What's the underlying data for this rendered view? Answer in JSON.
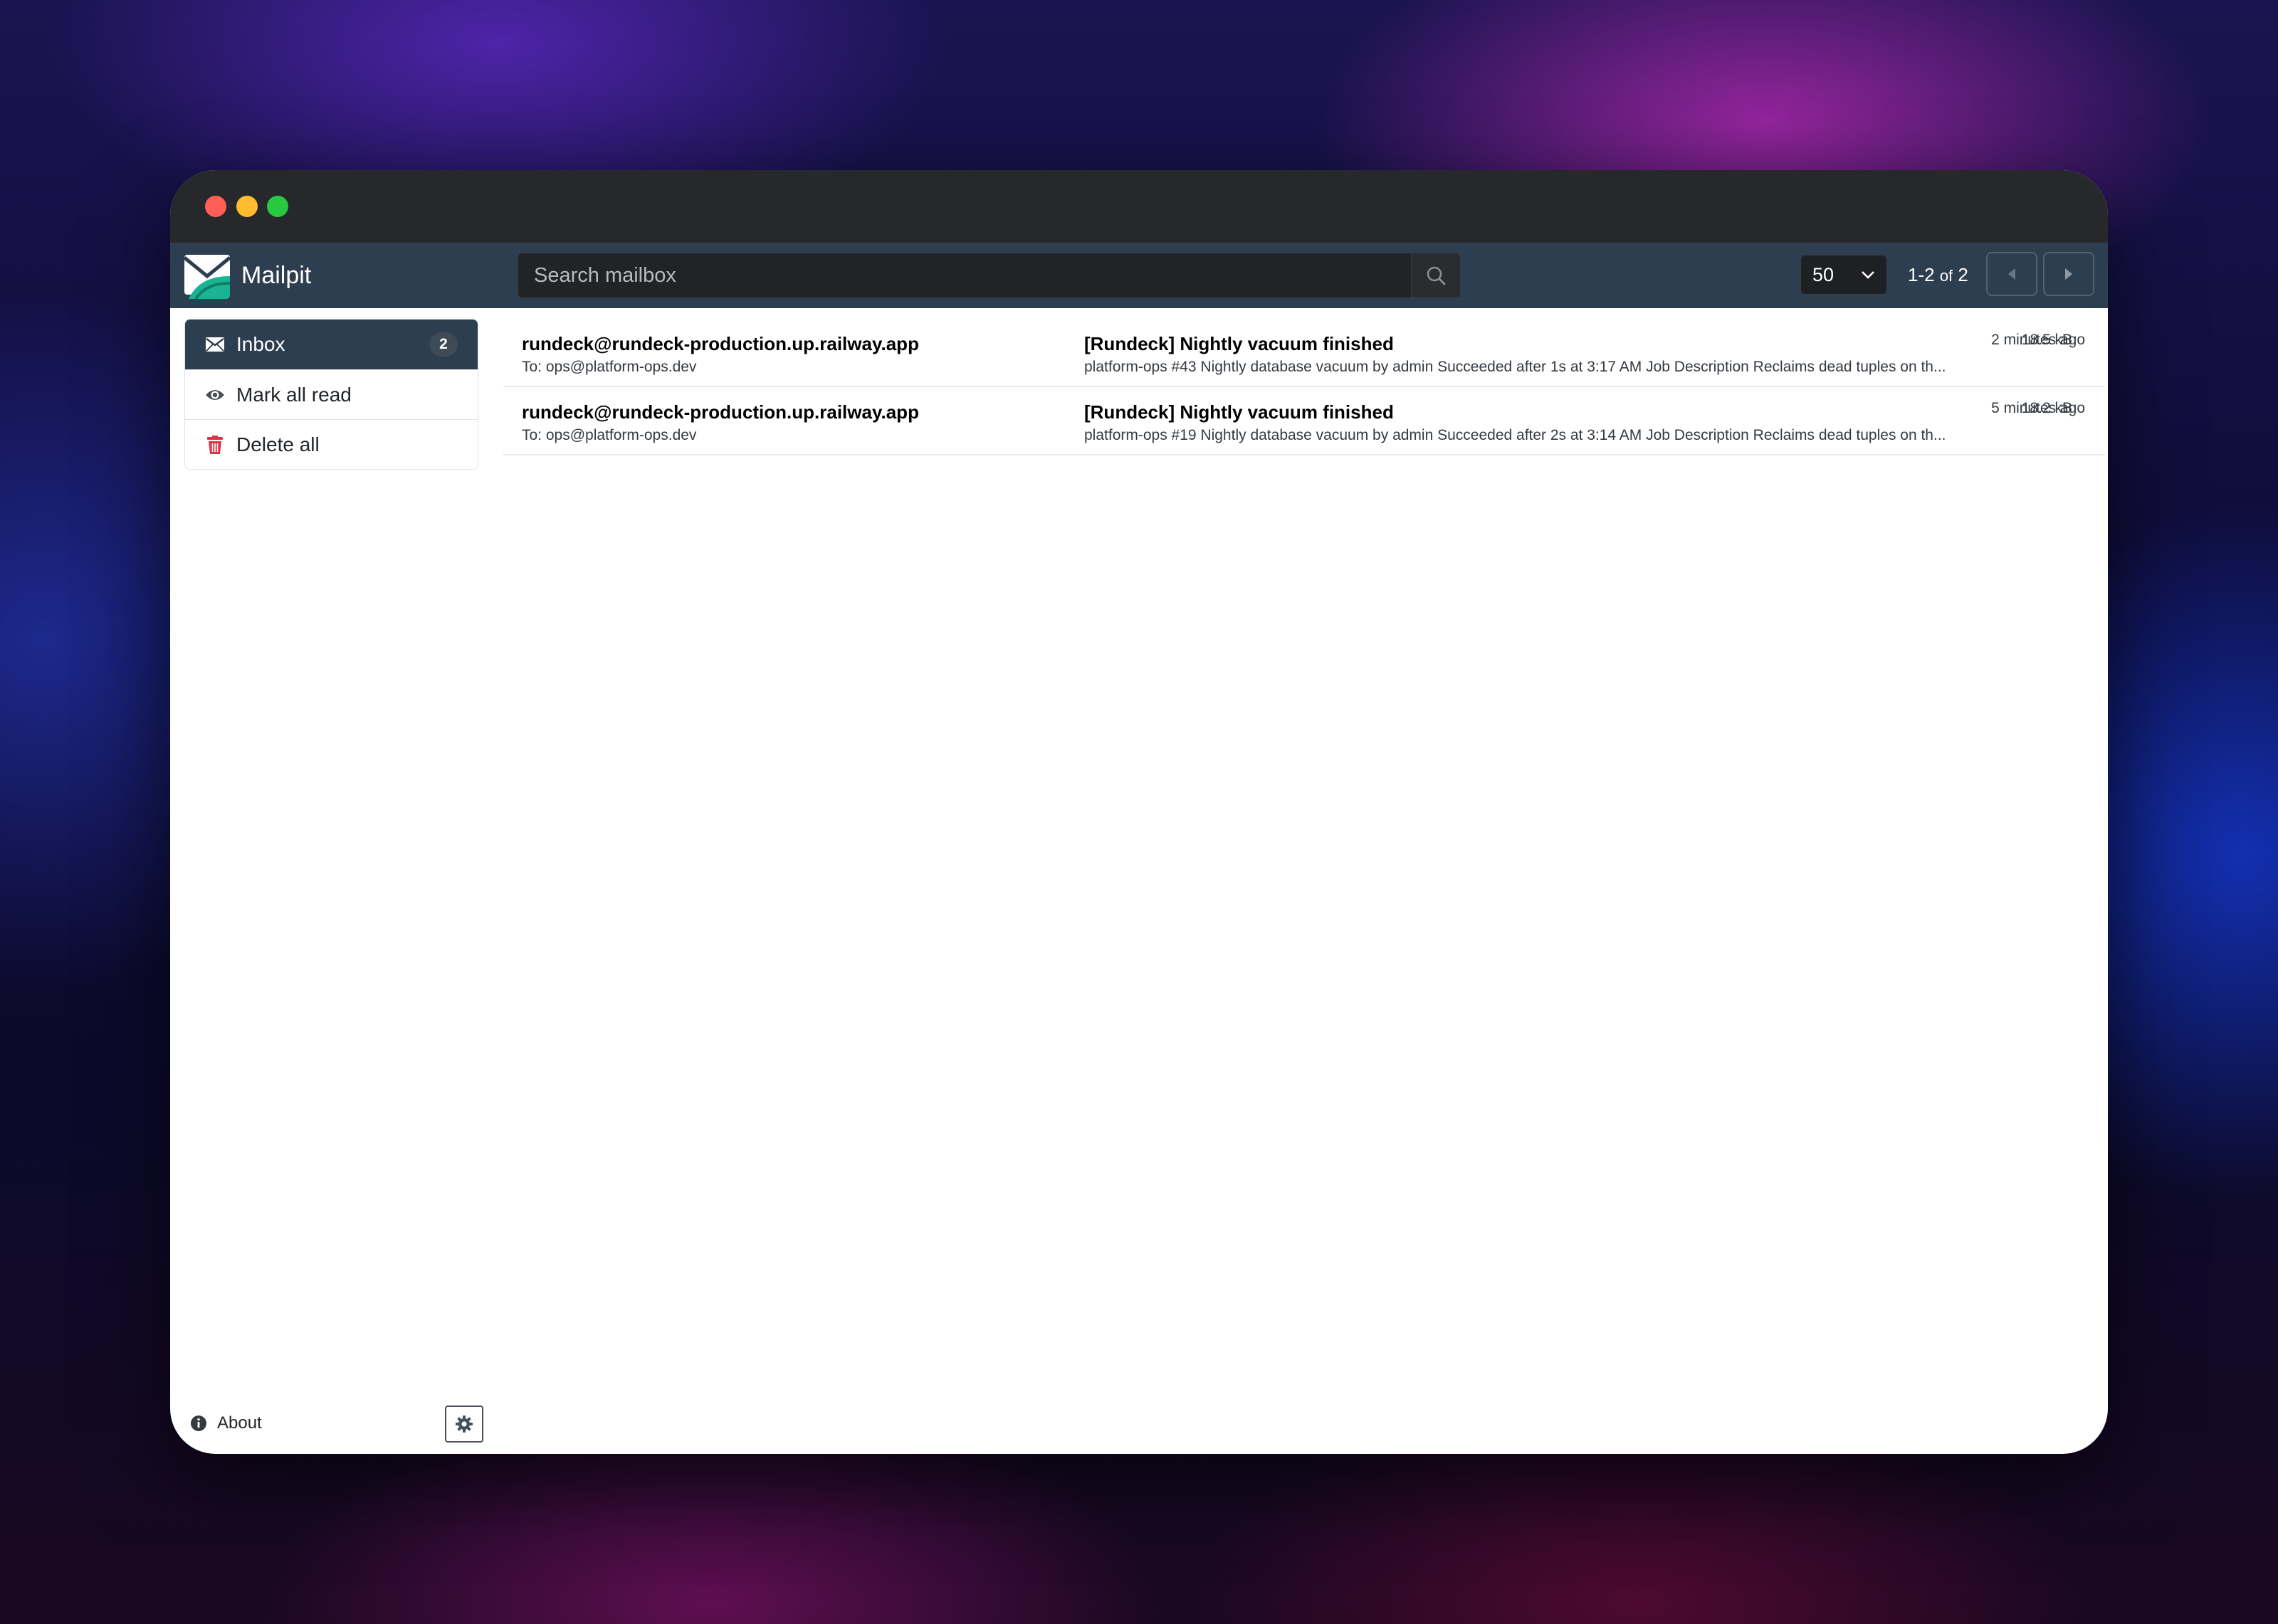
{
  "app": {
    "name": "Mailpit"
  },
  "search": {
    "placeholder": "Search mailbox"
  },
  "pagination": {
    "per_page": "50",
    "range": "1-2",
    "of_label": "of",
    "total": "2"
  },
  "sidebar": {
    "items": [
      {
        "label": "Inbox",
        "badge": "2",
        "icon": "envelope-icon"
      },
      {
        "label": "Mark all read",
        "icon": "eye-icon"
      },
      {
        "label": "Delete all",
        "icon": "trash-icon"
      }
    ]
  },
  "messages": [
    {
      "from": "rundeck@rundeck-production.up.railway.app",
      "to": "To: ops@platform-ops.dev",
      "subject": "[Rundeck] Nightly vacuum finished",
      "snippet": "platform-ops #43 Nightly database vacuum by admin Succeeded after 1s at 3:17 AM Job Description Reclaims dead tuples on th...",
      "size": "18.5 kB",
      "age": "2 minutes ago"
    },
    {
      "from": "rundeck@rundeck-production.up.railway.app",
      "to": "To: ops@platform-ops.dev",
      "subject": "[Rundeck] Nightly vacuum finished",
      "snippet": "platform-ops #19 Nightly database vacuum by admin Succeeded after 2s at 3:14 AM Job Description Reclaims dead tuples on th...",
      "size": "18.2 kB",
      "age": "5 minutes ago"
    }
  ],
  "footer": {
    "about_label": "About"
  },
  "colors": {
    "navbar": "#2d3e50",
    "titlebar": "#27282c",
    "danger": "#dc3545",
    "brand_green": "#1ab394"
  }
}
